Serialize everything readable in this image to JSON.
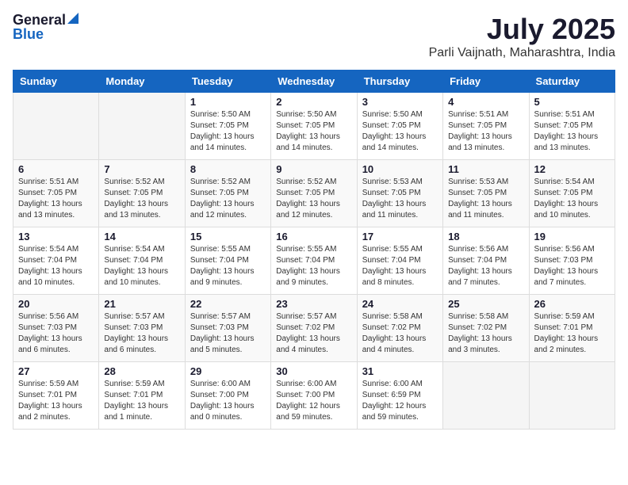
{
  "logo": {
    "general": "General",
    "blue": "Blue"
  },
  "header": {
    "month": "July 2025",
    "location": "Parli Vaijnath, Maharashtra, India"
  },
  "days": [
    "Sunday",
    "Monday",
    "Tuesday",
    "Wednesday",
    "Thursday",
    "Friday",
    "Saturday"
  ],
  "weeks": [
    [
      {
        "day": "",
        "content": ""
      },
      {
        "day": "",
        "content": ""
      },
      {
        "day": "1",
        "content": "Sunrise: 5:50 AM\nSunset: 7:05 PM\nDaylight: 13 hours\nand 14 minutes."
      },
      {
        "day": "2",
        "content": "Sunrise: 5:50 AM\nSunset: 7:05 PM\nDaylight: 13 hours\nand 14 minutes."
      },
      {
        "day": "3",
        "content": "Sunrise: 5:50 AM\nSunset: 7:05 PM\nDaylight: 13 hours\nand 14 minutes."
      },
      {
        "day": "4",
        "content": "Sunrise: 5:51 AM\nSunset: 7:05 PM\nDaylight: 13 hours\nand 13 minutes."
      },
      {
        "day": "5",
        "content": "Sunrise: 5:51 AM\nSunset: 7:05 PM\nDaylight: 13 hours\nand 13 minutes."
      }
    ],
    [
      {
        "day": "6",
        "content": "Sunrise: 5:51 AM\nSunset: 7:05 PM\nDaylight: 13 hours\nand 13 minutes."
      },
      {
        "day": "7",
        "content": "Sunrise: 5:52 AM\nSunset: 7:05 PM\nDaylight: 13 hours\nand 13 minutes."
      },
      {
        "day": "8",
        "content": "Sunrise: 5:52 AM\nSunset: 7:05 PM\nDaylight: 13 hours\nand 12 minutes."
      },
      {
        "day": "9",
        "content": "Sunrise: 5:52 AM\nSunset: 7:05 PM\nDaylight: 13 hours\nand 12 minutes."
      },
      {
        "day": "10",
        "content": "Sunrise: 5:53 AM\nSunset: 7:05 PM\nDaylight: 13 hours\nand 11 minutes."
      },
      {
        "day": "11",
        "content": "Sunrise: 5:53 AM\nSunset: 7:05 PM\nDaylight: 13 hours\nand 11 minutes."
      },
      {
        "day": "12",
        "content": "Sunrise: 5:54 AM\nSunset: 7:05 PM\nDaylight: 13 hours\nand 10 minutes."
      }
    ],
    [
      {
        "day": "13",
        "content": "Sunrise: 5:54 AM\nSunset: 7:04 PM\nDaylight: 13 hours\nand 10 minutes."
      },
      {
        "day": "14",
        "content": "Sunrise: 5:54 AM\nSunset: 7:04 PM\nDaylight: 13 hours\nand 10 minutes."
      },
      {
        "day": "15",
        "content": "Sunrise: 5:55 AM\nSunset: 7:04 PM\nDaylight: 13 hours\nand 9 minutes."
      },
      {
        "day": "16",
        "content": "Sunrise: 5:55 AM\nSunset: 7:04 PM\nDaylight: 13 hours\nand 9 minutes."
      },
      {
        "day": "17",
        "content": "Sunrise: 5:55 AM\nSunset: 7:04 PM\nDaylight: 13 hours\nand 8 minutes."
      },
      {
        "day": "18",
        "content": "Sunrise: 5:56 AM\nSunset: 7:04 PM\nDaylight: 13 hours\nand 7 minutes."
      },
      {
        "day": "19",
        "content": "Sunrise: 5:56 AM\nSunset: 7:03 PM\nDaylight: 13 hours\nand 7 minutes."
      }
    ],
    [
      {
        "day": "20",
        "content": "Sunrise: 5:56 AM\nSunset: 7:03 PM\nDaylight: 13 hours\nand 6 minutes."
      },
      {
        "day": "21",
        "content": "Sunrise: 5:57 AM\nSunset: 7:03 PM\nDaylight: 13 hours\nand 6 minutes."
      },
      {
        "day": "22",
        "content": "Sunrise: 5:57 AM\nSunset: 7:03 PM\nDaylight: 13 hours\nand 5 minutes."
      },
      {
        "day": "23",
        "content": "Sunrise: 5:57 AM\nSunset: 7:02 PM\nDaylight: 13 hours\nand 4 minutes."
      },
      {
        "day": "24",
        "content": "Sunrise: 5:58 AM\nSunset: 7:02 PM\nDaylight: 13 hours\nand 4 minutes."
      },
      {
        "day": "25",
        "content": "Sunrise: 5:58 AM\nSunset: 7:02 PM\nDaylight: 13 hours\nand 3 minutes."
      },
      {
        "day": "26",
        "content": "Sunrise: 5:59 AM\nSunset: 7:01 PM\nDaylight: 13 hours\nand 2 minutes."
      }
    ],
    [
      {
        "day": "27",
        "content": "Sunrise: 5:59 AM\nSunset: 7:01 PM\nDaylight: 13 hours\nand 2 minutes."
      },
      {
        "day": "28",
        "content": "Sunrise: 5:59 AM\nSunset: 7:01 PM\nDaylight: 13 hours\nand 1 minute."
      },
      {
        "day": "29",
        "content": "Sunrise: 6:00 AM\nSunset: 7:00 PM\nDaylight: 13 hours\nand 0 minutes."
      },
      {
        "day": "30",
        "content": "Sunrise: 6:00 AM\nSunset: 7:00 PM\nDaylight: 12 hours\nand 59 minutes."
      },
      {
        "day": "31",
        "content": "Sunrise: 6:00 AM\nSunset: 6:59 PM\nDaylight: 12 hours\nand 59 minutes."
      },
      {
        "day": "",
        "content": ""
      },
      {
        "day": "",
        "content": ""
      }
    ]
  ]
}
